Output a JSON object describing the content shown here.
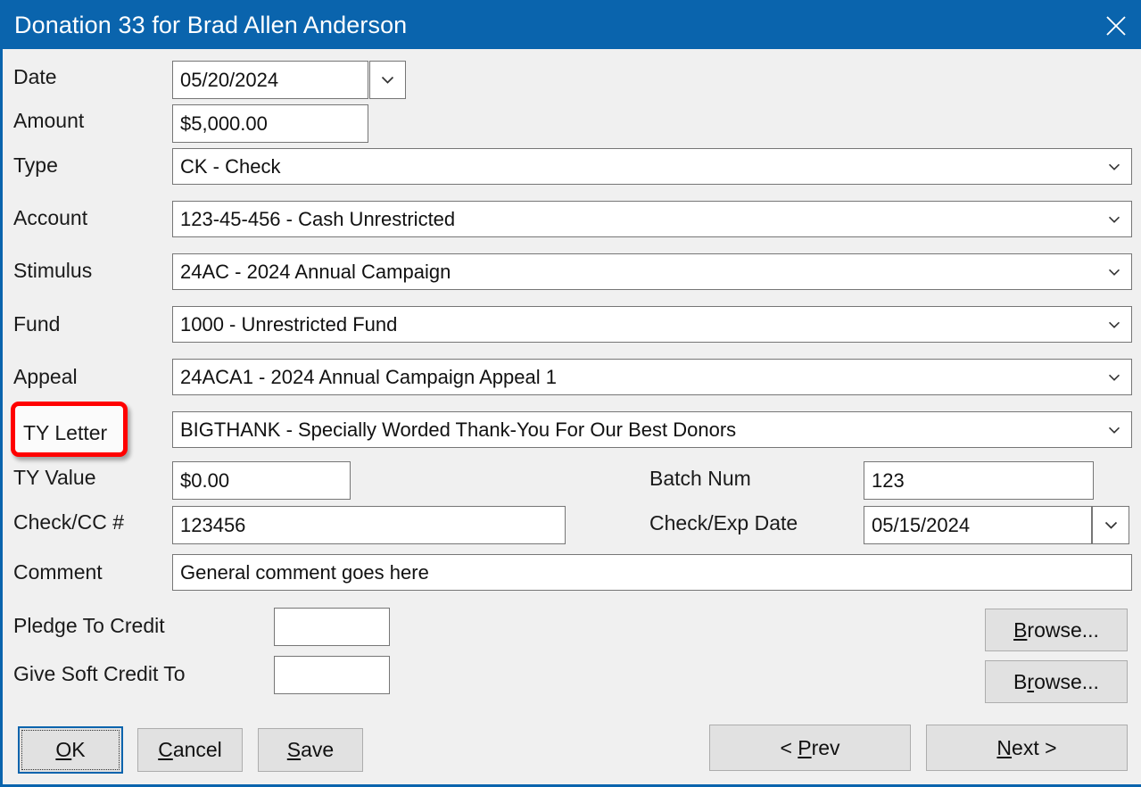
{
  "window": {
    "title": "Donation 33 for Brad Allen Anderson",
    "close_icon": "close-icon",
    "titlebar_color": "#0a64ad",
    "body_color": "#f0f0f0",
    "highlight_color": "#ff0000"
  },
  "fields": {
    "date": {
      "label": "Date",
      "value": "05/20/2024",
      "dropdown_icon": "chevron-down-icon"
    },
    "amount": {
      "label": "Amount",
      "value": "$5,000.00"
    },
    "type": {
      "label": "Type",
      "value": "CK - Check",
      "dropdown_icon": "chevron-down-icon"
    },
    "account": {
      "label": "Account",
      "value": "123-45-456 - Cash Unrestricted",
      "dropdown_icon": "chevron-down-icon"
    },
    "stimulus": {
      "label": "Stimulus",
      "value": "24AC - 2024 Annual Campaign",
      "dropdown_icon": "chevron-down-icon"
    },
    "fund": {
      "label": "Fund",
      "value": "1000 - Unrestricted Fund",
      "dropdown_icon": "chevron-down-icon"
    },
    "appeal": {
      "label": "Appeal",
      "value": "24ACA1 - 2024 Annual Campaign Appeal 1",
      "dropdown_icon": "chevron-down-icon"
    },
    "ty_letter": {
      "label": "TY Letter",
      "value": "BIGTHANK - Specially Worded Thank-You For Our Best Donors",
      "dropdown_icon": "chevron-down-icon",
      "highlighted": true
    },
    "ty_value": {
      "label": "TY Value",
      "value": "$0.00"
    },
    "batch_num": {
      "label": "Batch Num",
      "value": "123"
    },
    "check_cc_num": {
      "label": "Check/CC #",
      "value": "123456"
    },
    "check_exp_date": {
      "label": "Check/Exp Date",
      "value": "05/15/2024",
      "dropdown_icon": "chevron-down-icon"
    },
    "comment": {
      "label": "Comment",
      "value": "General comment goes here"
    },
    "pledge_to_credit": {
      "label": "Pledge To Credit",
      "value": "",
      "placeholder": ""
    },
    "give_soft_credit_to": {
      "label": "Give Soft Credit To",
      "value": "",
      "placeholder": ""
    }
  },
  "buttons": {
    "browse_pledge": {
      "pre": "",
      "mnemonic": "B",
      "post": "rowse..."
    },
    "browse_soft": {
      "pre": "B",
      "mnemonic": "r",
      "post": "owse..."
    },
    "ok": {
      "pre": "",
      "mnemonic": "O",
      "post": "K"
    },
    "cancel": {
      "pre": "",
      "mnemonic": "C",
      "post": "ancel"
    },
    "save": {
      "pre": "",
      "mnemonic": "S",
      "post": "ave"
    },
    "prev": {
      "pre": "< ",
      "mnemonic": "P",
      "post": "rev"
    },
    "next": {
      "pre": "",
      "mnemonic": "N",
      "post": "ext >"
    }
  }
}
